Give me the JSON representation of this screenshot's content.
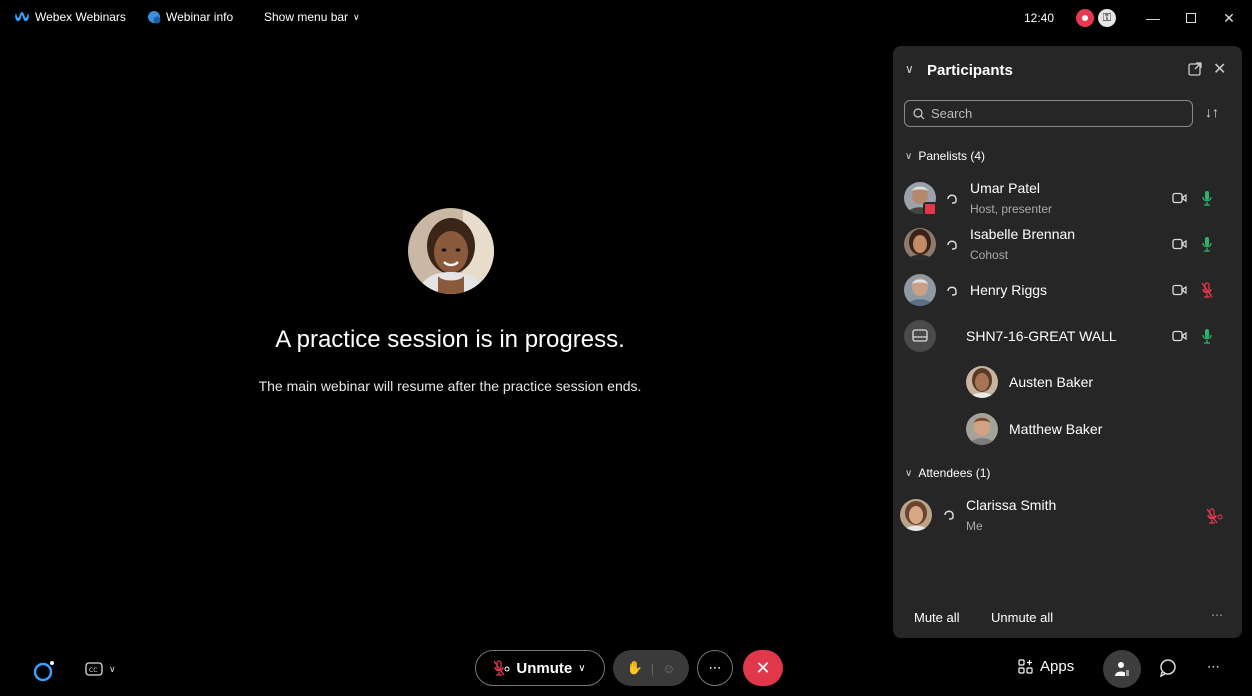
{
  "titlebar": {
    "app_name": "Webex Webinars",
    "webinar_info": "Webinar info",
    "show_menu_bar": "Show menu bar",
    "time": "12:40"
  },
  "stage": {
    "title": "A practice session is in progress.",
    "subtitle": "The main webinar will resume after the practice session ends."
  },
  "participants_panel": {
    "title": "Participants",
    "search_placeholder": "Search",
    "panelists_header": "Panelists (4)",
    "panelists": [
      {
        "name": "Umar Patel",
        "role": "Host, presenter",
        "mic": "unmuted"
      },
      {
        "name": "Isabelle Brennan",
        "role": "Cohost",
        "mic": "unmuted"
      },
      {
        "name": "Henry Riggs",
        "role": "",
        "mic": "muted"
      },
      {
        "name": "SHN7-16-GREAT WALL",
        "role": "",
        "mic": "unmuted"
      }
    ],
    "device_members": [
      {
        "name": "Austen Baker"
      },
      {
        "name": "Matthew Baker"
      }
    ],
    "attendees_header": "Attendees (1)",
    "attendees": [
      {
        "name": "Clarissa Smith",
        "role": "Me",
        "mic": "muted"
      }
    ],
    "mute_all": "Mute all",
    "unmute_all": "Unmute all"
  },
  "bottombar": {
    "unmute_label": "Unmute",
    "apps_label": "Apps"
  },
  "colors": {
    "accent_red": "#e0374a",
    "mic_green": "#2fb36b",
    "mic_muted_red": "#e8384f",
    "panel_bg": "#262626"
  }
}
